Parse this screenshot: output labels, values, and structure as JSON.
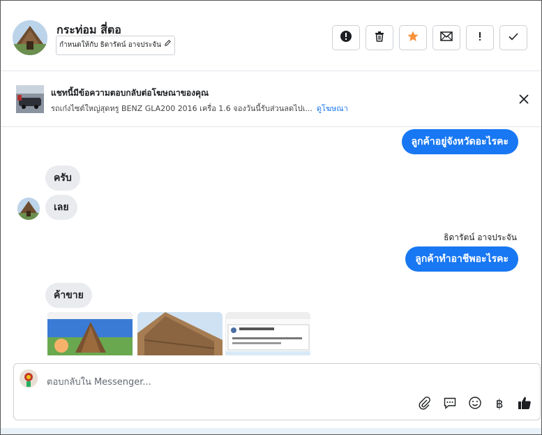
{
  "header": {
    "name": "กระท่อม สี่ตอ",
    "assign_label": "กำหนดให้กับ ธิดารัตน์ อาจประจัน",
    "icons": [
      "alert-icon",
      "trash-icon",
      "star-icon",
      "mail-icon",
      "exclamation-icon",
      "check-icon"
    ]
  },
  "ad": {
    "title": "แชทนี้มีข้อความตอบกลับต่อโฆษณาของคุณ",
    "desc": "รถเก๋งไซต์ใหญ่สุดหรู BENZ GLA200 2016 เครื่อ 1.6 จองวันนี้รับส่วนลดไปเ...",
    "link": "ดูโฆษณา"
  },
  "messages": {
    "out1": "ลูกค้าอยู่จังหวัดอะไรคะ",
    "in1": "ครับ",
    "in2": "เลย",
    "sender": "ธิดารัตน์ อาจประจัน",
    "out2": "ลูกค้าทำอาชีพอะไรคะ",
    "in3": "ค้าขาย"
  },
  "composer": {
    "placeholder": "ตอบกลับใน Messenger...",
    "icons": [
      "attach-icon",
      "saved-reply-icon",
      "emoji-icon",
      "baht-icon",
      "like-icon"
    ]
  },
  "colors": {
    "accent": "#1877f2",
    "incoming_bubble": "#e9ebee",
    "star": "#f7923b"
  }
}
